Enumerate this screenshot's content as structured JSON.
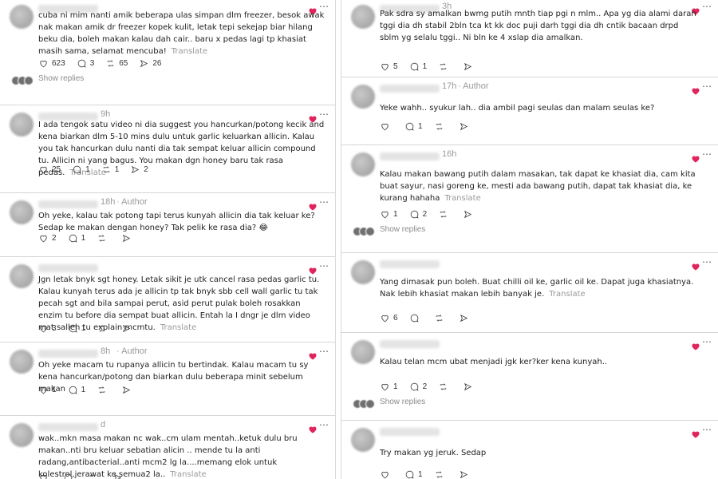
{
  "translate_label": "Translate",
  "show_replies_label": "Show replies",
  "author_label": "Author",
  "left": [
    {
      "time": "",
      "author": false,
      "text": "cuba ni mim nanti amik beberapa ulas simpan dlm freezer, besok awak nak makan amik dr freezer kopek kulit, letak tepi sekejap biar hilang beku dia, boleh makan kalau dah cair.. baru x pedas lagi tp khasiat masih sama, selamat mencuba!",
      "translate": true,
      "likes": "623",
      "replies": "3",
      "reposts": "65",
      "shares": "26",
      "show_replies": true
    },
    {
      "time": "9h",
      "author": false,
      "text": "I ada tengok satu video ni dia suggest you hancurkan/potong kecik and kena biarkan dlm 5-10 mins dulu untuk garlic keluarkan allicin. Kalau you tak hancurkan dulu nanti dia tak sempat keluar allicin compound tu. Allicin ni yang bagus. You makan dgn honey baru tak rasa pedas.",
      "translate": true,
      "likes": "25",
      "replies": "1",
      "reposts": "1",
      "shares": "2",
      "show_replies": false
    },
    {
      "time": "18h",
      "author": true,
      "text": "Oh yeke, kalau tak potong tapi terus kunyah allicin dia tak keluar ke? Sedap ke makan dengan honey? Tak pelik ke rasa dia? 😂",
      "translate": false,
      "likes": "2",
      "replies": "1",
      "reposts": "",
      "shares": "",
      "show_replies": false
    },
    {
      "time": "",
      "author": false,
      "text": "Jgn letak bnyk sgt honey. Letak sikit je utk cancel rasa pedas garlic tu. Kalau kunyah terus ada je allicin tp tak bnyk sbb cell wall garlic tu tak pecah sgt and bila sampai perut, asid perut pulak boleh rosakkan enzim tu before dia sempat buat allicin. Entah la I dngr je dlm video mat salleh tu explain mcmtu.",
      "translate": true,
      "likes": "3",
      "replies": "1",
      "reposts": "",
      "shares": "",
      "show_replies": false
    },
    {
      "time": "8h",
      "author": true,
      "text": "Oh yeke macam tu rupanya allicin tu bertindak. Kalau macam tu sy kena hancurkan/potong dan biarkan dulu beberapa minit sebelum makan",
      "translate": false,
      "likes": "1",
      "replies": "1",
      "reposts": "",
      "shares": "",
      "show_replies": false
    },
    {
      "time": "d",
      "author": false,
      "text": "wak..mkn masa makan nc wak..cm ulam mentah..ketuk dulu bru makan..nti bru keluar sebatian alicin .. mende tu la anti radang,antibacterial..anti mcm2 lg la....memang elok untuk kolestrol,jerawat ke.semua2 la..",
      "translate": true,
      "likes": "",
      "replies": "",
      "reposts": "",
      "shares": "",
      "show_replies": false
    }
  ],
  "right": [
    {
      "time": "3h",
      "author": false,
      "text": "Pak sdra sy amalkan bwmg putih mnth tiap pgi n mlm.. Apa yg dia alami darah tggi dia dh stabil 2bln tca kt kk doc puji darh tggi dia dh cntik bacaan drpd sblm yg selalu tggi.. Ni bln ke 4 xslap dia amalkan.",
      "translate": false,
      "likes": "5",
      "replies": "1",
      "reposts": "",
      "shares": "",
      "show_replies": false
    },
    {
      "time": "17h",
      "author": true,
      "text": "Yeke wahh.. syukur lah.. dia ambil pagi seulas dan malam seulas ke?",
      "translate": false,
      "likes": "",
      "replies": "1",
      "reposts": "",
      "shares": "",
      "show_replies": false
    },
    {
      "time": "16h",
      "author": false,
      "text": "Kalau makan bawang putih dalam masakan, tak dapat ke khasiat dia, cam kita buat sayur, nasi goreng ke, mesti ada bawang putih, dapat tak khasiat dia, ke kurang hahaha",
      "translate": true,
      "likes": "1",
      "replies": "2",
      "reposts": "",
      "shares": "",
      "show_replies": true
    },
    {
      "time": "",
      "author": false,
      "text": "Yang dimasak pun boleh. Buat chilli oil ke, garlic oil ke. Dapat juga khasiatnya. Nak lebih khasiat makan lebih banyak je.",
      "translate": true,
      "likes": "6",
      "replies": "",
      "reposts": "",
      "shares": "",
      "show_replies": false
    },
    {
      "time": "",
      "author": false,
      "text": "Kalau telan mcm ubat menjadi jgk ker?ker kena kunyah..",
      "translate": false,
      "likes": "1",
      "replies": "2",
      "reposts": "",
      "shares": "",
      "show_replies": true
    },
    {
      "time": "",
      "author": false,
      "text": "Try makan yg jeruk. Sedap",
      "translate": false,
      "likes": "",
      "replies": "1",
      "reposts": "",
      "shares": "",
      "show_replies": false
    }
  ]
}
